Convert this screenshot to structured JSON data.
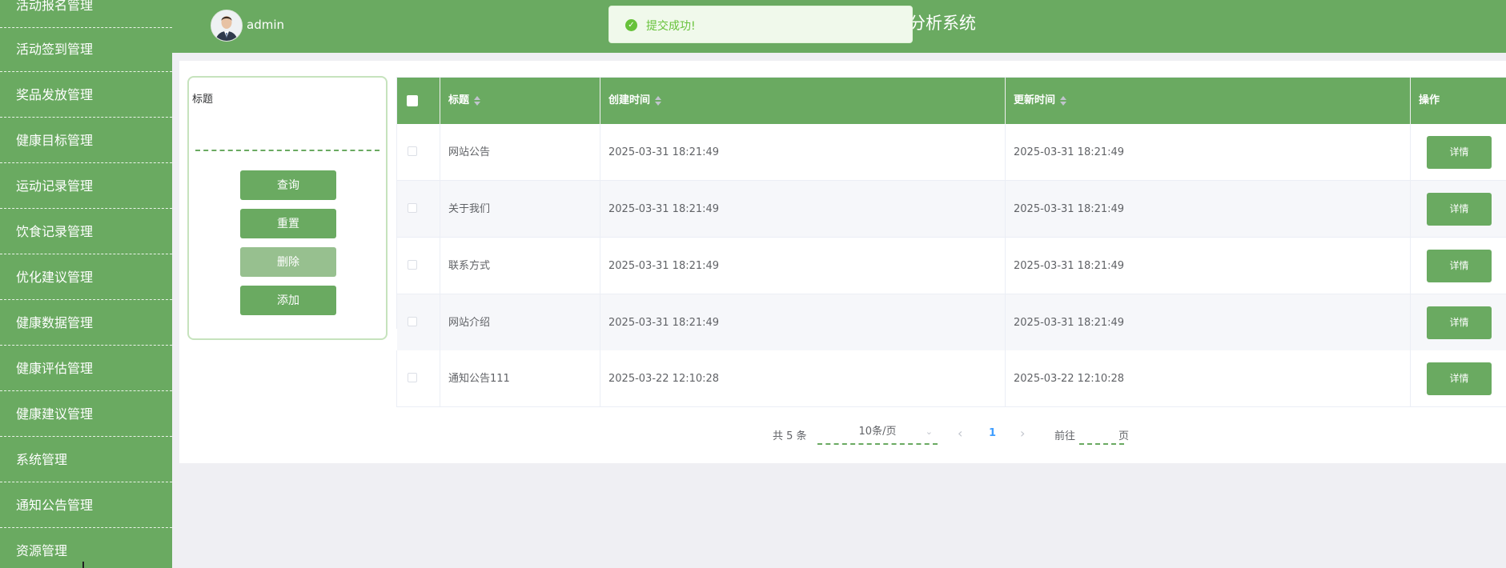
{
  "sidebar": {
    "items": [
      {
        "label": "活动报名管理"
      },
      {
        "label": "活动签到管理"
      },
      {
        "label": "奖品发放管理"
      },
      {
        "label": "健康目标管理"
      },
      {
        "label": "运动记录管理"
      },
      {
        "label": "饮食记录管理"
      },
      {
        "label": "优化建议管理"
      },
      {
        "label": "健康数据管理"
      },
      {
        "label": "健康评估管理"
      },
      {
        "label": "健康建议管理"
      },
      {
        "label": "系统管理"
      },
      {
        "label": "通知公告管理"
      },
      {
        "label": "资源管理"
      }
    ]
  },
  "header": {
    "username": "admin",
    "system_title": "分析系统",
    "avatar_icon": "user-avatar-icon"
  },
  "toast": {
    "message": "提交成功!",
    "icon": "check-circle-icon",
    "color": "#67c23a"
  },
  "search": {
    "label": "标题",
    "placeholder": "",
    "buttons": {
      "query": "查询",
      "reset": "重置",
      "delete": "删除",
      "add": "添加"
    }
  },
  "table": {
    "columns": {
      "title": "标题",
      "created": "创建时间",
      "updated": "更新时间",
      "actions": "操作"
    },
    "rows": [
      {
        "title": "网站公告",
        "created": "2025-03-31 18:21:49",
        "updated": "2025-03-31 18:21:49",
        "action": "详情"
      },
      {
        "title": "关于我们",
        "created": "2025-03-31 18:21:49",
        "updated": "2025-03-31 18:21:49",
        "action": "详情"
      },
      {
        "title": "联系方式",
        "created": "2025-03-31 18:21:49",
        "updated": "2025-03-31 18:21:49",
        "action": "详情"
      },
      {
        "title": "网站介绍",
        "created": "2025-03-31 18:21:49",
        "updated": "2025-03-31 18:21:49",
        "action": "详情"
      },
      {
        "title": "通知公告111",
        "created": "2025-03-22 12:10:28",
        "updated": "2025-03-22 12:10:28",
        "action": "详情"
      }
    ]
  },
  "pagination": {
    "total": "共 5 条",
    "page_size": "10条/页",
    "prev": "‹",
    "current": "1",
    "next": "›",
    "goto_prefix": "前往",
    "goto_suffix": "页"
  },
  "colors": {
    "primary": "#6aaa61",
    "background": "#efeff3",
    "active_page": "#409eff"
  }
}
